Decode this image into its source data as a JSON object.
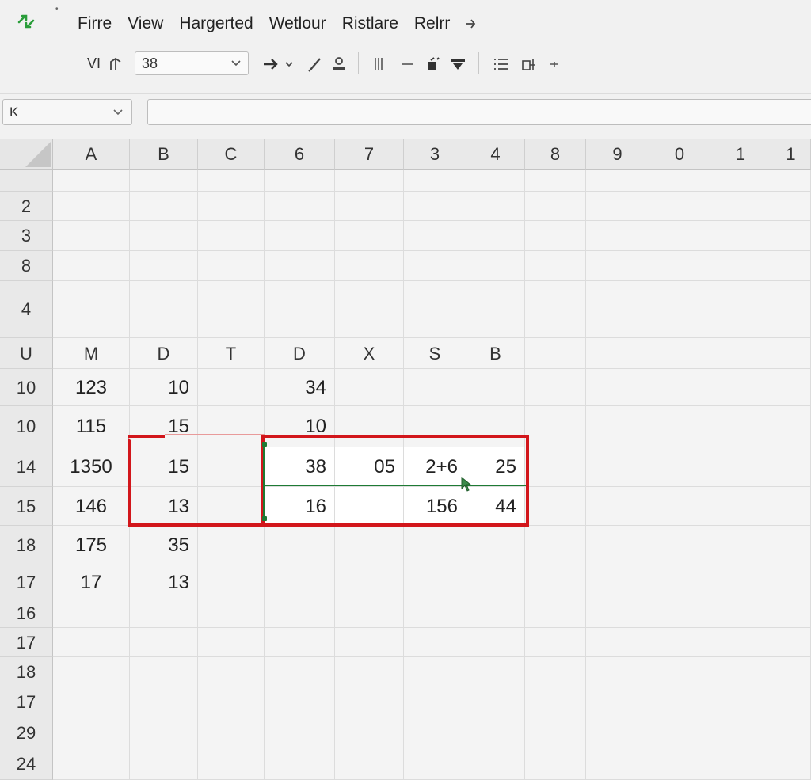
{
  "menu": {
    "items": [
      "Firre",
      "View",
      "Hargerted",
      "Wetlour",
      "Ristlare",
      "Relrr"
    ]
  },
  "toolbar": {
    "vi_label": "VI",
    "font_size_value": "38"
  },
  "name_box": {
    "value": "K"
  },
  "formula_bar": {
    "value": ""
  },
  "grid": {
    "column_headers": [
      "A",
      "B",
      "C",
      "6",
      "7",
      "3",
      "4",
      "8",
      "9",
      "0",
      "1",
      "1"
    ],
    "row_headers": [
      "2",
      "3",
      "8",
      "4",
      "U",
      "10",
      "10",
      "14",
      "15",
      "18",
      "17",
      "16",
      "17",
      "18",
      "17",
      "29",
      "24"
    ],
    "row_u_labels": [
      "M",
      "D",
      "T",
      "D",
      "X",
      "S",
      "B"
    ],
    "rows": [
      {
        "values": [
          "123",
          "10",
          "",
          "34",
          "",
          "",
          ""
        ]
      },
      {
        "values": [
          "115",
          "15",
          "",
          "10",
          "",
          "",
          ""
        ]
      },
      {
        "values": [
          "1350",
          "15",
          "",
          "38",
          "05",
          "2+6",
          "25"
        ]
      },
      {
        "values": [
          "146",
          "13",
          "",
          "16",
          "",
          "156",
          "44"
        ]
      },
      {
        "values": [
          "175",
          "35",
          "",
          "",
          "",
          "",
          ""
        ]
      },
      {
        "values": [
          "17",
          "13",
          "",
          "",
          "",
          "",
          ""
        ]
      }
    ]
  },
  "colors": {
    "accent_green": "#1e7b34",
    "selection_red": "#d2161b"
  },
  "icons": [
    "sync-arrows-icon",
    "arrow-right-icon",
    "chevron-down-icon",
    "pen-icon",
    "user-icon",
    "column-icon",
    "minus-icon",
    "paint-bucket-icon",
    "filter-icon",
    "list-icon",
    "sort-icon",
    "mouse-cursor-icon"
  ]
}
